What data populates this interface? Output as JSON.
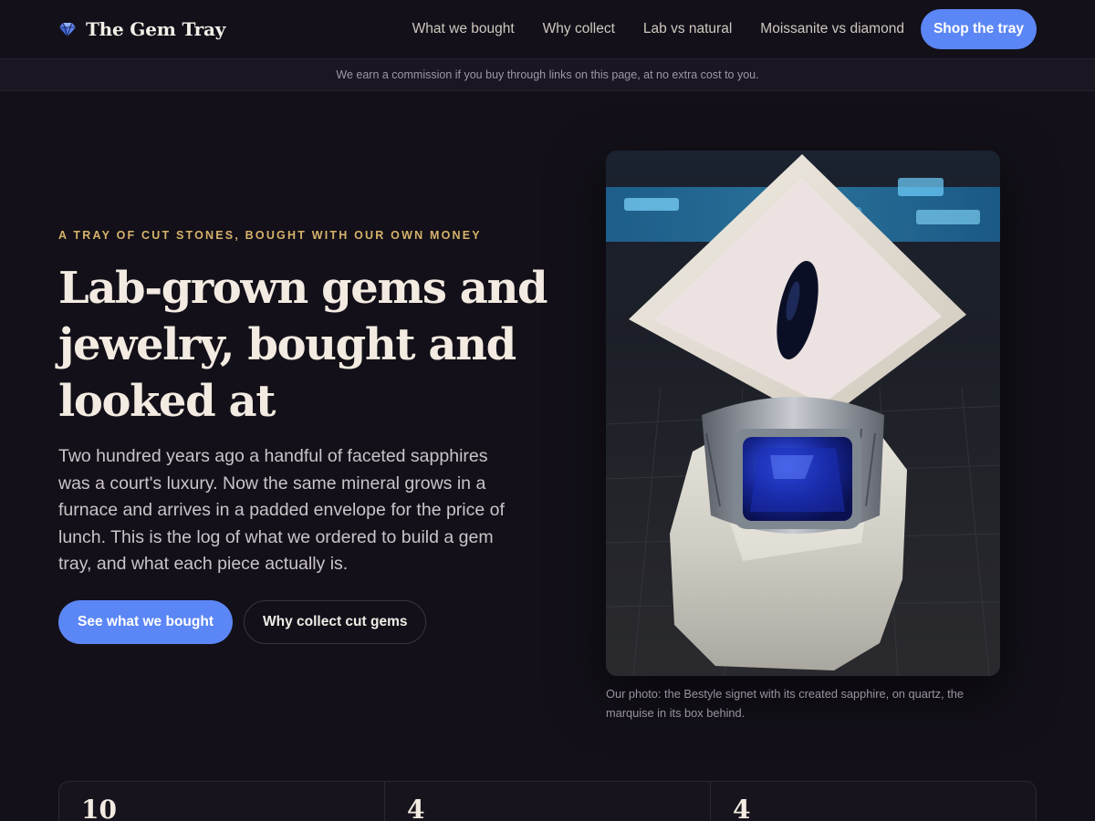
{
  "site": {
    "brand_name": "The Gem Tray",
    "brand_icon": "diamond-icon",
    "accent_color": "#5b86f5",
    "eyebrow_color": "#d6b26b"
  },
  "nav": {
    "links": [
      "What we bought",
      "Why collect",
      "Lab vs natural",
      "Moissanite vs diamond"
    ],
    "cta_label": "Shop the tray"
  },
  "disclosure": "We earn a commission if you buy through links on this page, at no extra cost to you.",
  "hero": {
    "eyebrow": "A tray of cut stones, bought with our own money",
    "title": "Lab-grown gems and jewelry, bought and looked at",
    "copy": "Two hundred years ago a handful of faceted sapphires was a court's luxury. Now the same mineral grows in a furnace and arrives in a padded envelope for the price of lunch. This is the log of what we ordered to build a gem tray, and what each piece actually is.",
    "primary_cta": "See what we bought",
    "secondary_cta": "Why collect cut gems",
    "photo_caption": "Our photo: the Bestyle signet with its created sapphire, on quartz, the marquise in its box behind."
  },
  "stats": [
    {
      "value": "10"
    },
    {
      "value": "4"
    },
    {
      "value": "4"
    }
  ]
}
